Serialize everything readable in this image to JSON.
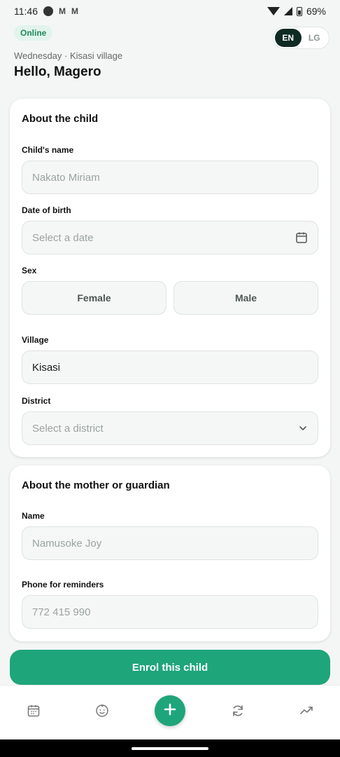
{
  "status_bar": {
    "time": "11:46",
    "mail1": "M",
    "mail2": "M",
    "battery": "69%"
  },
  "header": {
    "online_badge": "Online",
    "lang_options": [
      "EN",
      "LG"
    ],
    "lang_active": "EN",
    "day_location": "Wednesday · Kisasi village",
    "greeting": "Hello, Magero"
  },
  "child_section": {
    "title": "About the child",
    "name_label": "Child's name",
    "name_placeholder": "Nakato Miriam",
    "dob_label": "Date of birth",
    "dob_placeholder": "Select a date",
    "sex_label": "Sex",
    "sex_options": [
      "Female",
      "Male"
    ],
    "village_label": "Village",
    "village_value": "Kisasi",
    "district_label": "District",
    "district_placeholder": "Select a district"
  },
  "guardian_section": {
    "title": "About the mother or guardian",
    "name_label": "Name",
    "name_placeholder": "Namusoke Joy",
    "phone_label": "Phone for reminders",
    "phone_placeholder": "772 415 990"
  },
  "enrol_button": "Enrol this child",
  "bottom_nav": {
    "items": [
      "calendar-icon",
      "baby-face-icon",
      "plus-icon",
      "sync-icon",
      "trend-icon"
    ]
  },
  "colors": {
    "accent": "#1fa57a",
    "lang_active_bg": "#0f2a22",
    "online_bg": "#e2f4ec",
    "online_text": "#1f8a5e"
  }
}
